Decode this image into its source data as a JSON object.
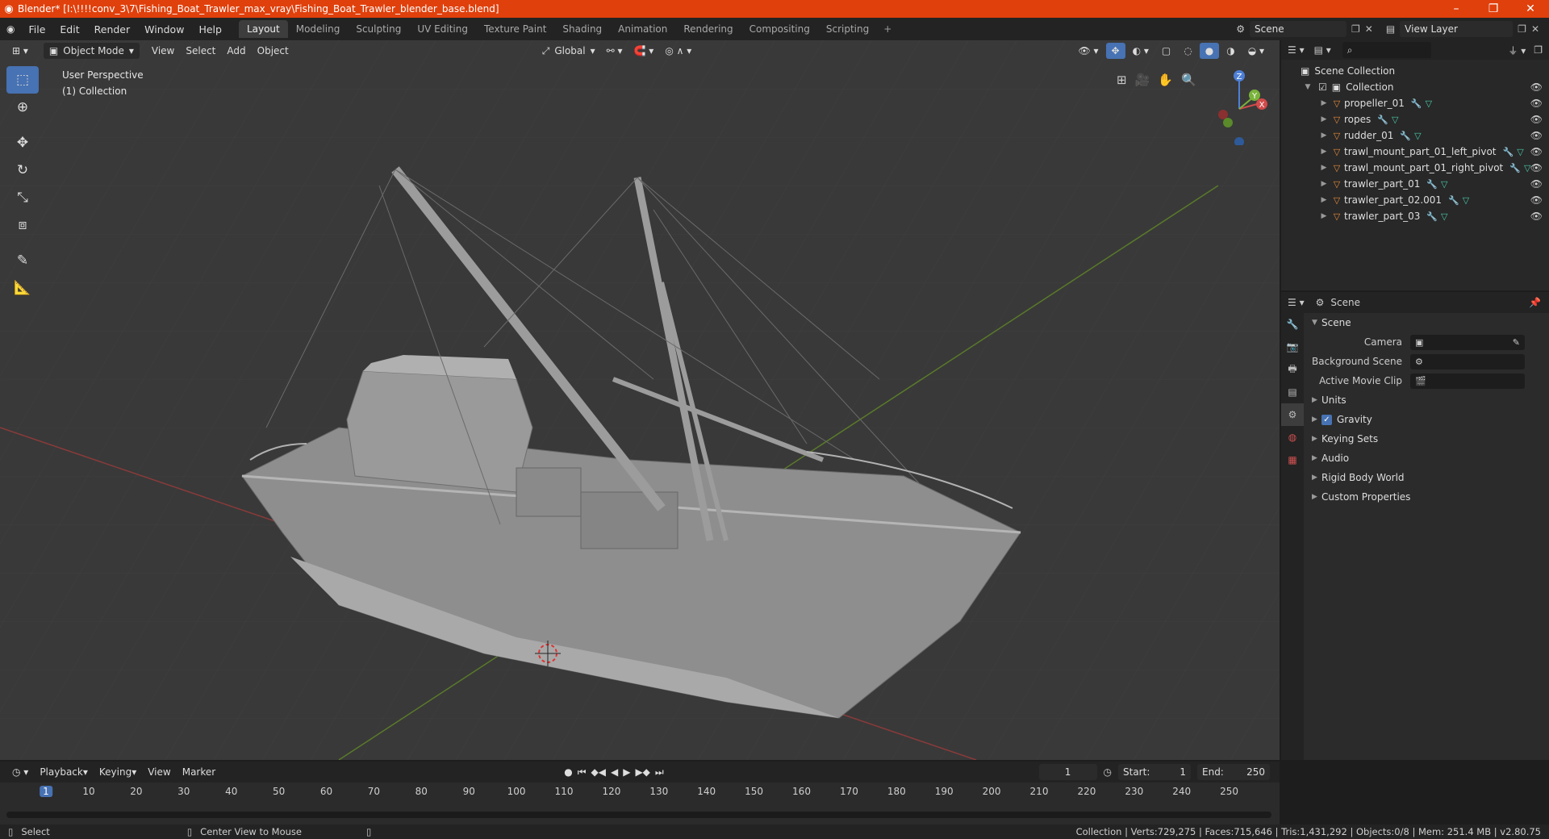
{
  "window": {
    "title": "Blender* [I:\\!!!!conv_3\\7\\Fishing_Boat_Trawler_max_vray\\Fishing_Boat_Trawler_blender_base.blend]"
  },
  "menu": [
    "File",
    "Edit",
    "Render",
    "Window",
    "Help"
  ],
  "workspaces": [
    "Layout",
    "Modeling",
    "Sculpting",
    "UV Editing",
    "Texture Paint",
    "Shading",
    "Animation",
    "Rendering",
    "Compositing",
    "Scripting"
  ],
  "active_workspace": "Layout",
  "top_right": {
    "scene": "Scene",
    "view_layer": "View Layer"
  },
  "viewport": {
    "mode": "Object Mode",
    "menus": [
      "View",
      "Select",
      "Add",
      "Object"
    ],
    "transform": "Global",
    "info_line1": "User Perspective",
    "info_line2": "(1) Collection",
    "gizmo": {
      "x": "X",
      "y": "Y",
      "z": "Z"
    }
  },
  "outliner": {
    "root": "Scene Collection",
    "collection": "Collection",
    "objects": [
      "propeller_01",
      "ropes",
      "rudder_01",
      "trawl_mount_part_01_left_pivot",
      "trawl_mount_part_01_right_pivot",
      "trawler_part_01",
      "trawler_part_02.001",
      "trawler_part_03"
    ]
  },
  "properties": {
    "context": "Scene",
    "panel": "Scene",
    "fields": [
      {
        "label": "Camera",
        "value": ""
      },
      {
        "label": "Background Scene",
        "value": ""
      },
      {
        "label": "Active Movie Clip",
        "value": ""
      }
    ],
    "sections": [
      "Units",
      "Gravity",
      "Keying Sets",
      "Audio",
      "Rigid Body World",
      "Custom Properties"
    ],
    "gravity_checked": true
  },
  "timeline": {
    "menus": [
      "Playback",
      "Keying",
      "View",
      "Marker"
    ],
    "current_frame": "1",
    "start_label": "Start:",
    "start": "1",
    "end_label": "End:",
    "end": "250",
    "ruler": [
      "1",
      "10",
      "20",
      "30",
      "40",
      "50",
      "60",
      "70",
      "80",
      "90",
      "100",
      "110",
      "120",
      "130",
      "140",
      "150",
      "160",
      "170",
      "180",
      "190",
      "200",
      "210",
      "220",
      "230",
      "240",
      "250"
    ]
  },
  "status": {
    "left1": "Select",
    "left2": "Center View to Mouse",
    "right": "Collection | Verts:729,275 | Faces:715,646 | Tris:1,431,292 | Objects:0/8 | Mem: 251.4 MB | v2.80.75"
  }
}
